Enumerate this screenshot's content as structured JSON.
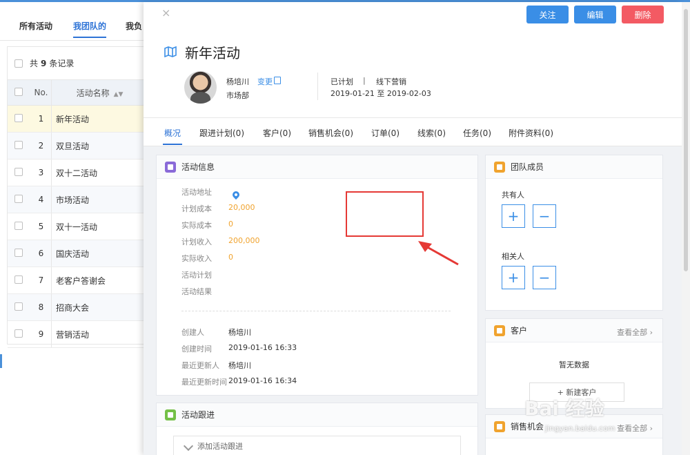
{
  "list_page": {
    "tabs": [
      "所有活动",
      "我团队的",
      "我负"
    ],
    "count": {
      "prefix": "共",
      "number": "9",
      "suffix": "条记录"
    },
    "columns": {
      "no": "No.",
      "name": "活动名称"
    },
    "rows": [
      {
        "no": "1",
        "name": "新年活动"
      },
      {
        "no": "2",
        "name": "双旦活动"
      },
      {
        "no": "3",
        "name": "双十二活动"
      },
      {
        "no": "4",
        "name": "市场活动"
      },
      {
        "no": "5",
        "name": "双十一活动"
      },
      {
        "no": "6",
        "name": "国庆活动"
      },
      {
        "no": "7",
        "name": "老客户答谢会"
      },
      {
        "no": "8",
        "name": "招商大会"
      },
      {
        "no": "9",
        "name": "营销活动"
      }
    ]
  },
  "drawer": {
    "close": "×",
    "buttons": {
      "follow": "关注",
      "edit": "编辑",
      "delete": "删除"
    },
    "title": "新年活动",
    "owner": {
      "name": "杨培川",
      "change": "变更",
      "dept": "市场部"
    },
    "status": "已计划",
    "pipe": "|",
    "type": "线下营销",
    "date_range": "2019-01-21 至 2019-02-03",
    "tabs": [
      "概况",
      "跟进计划(0)",
      "客户(0)",
      "销售机会(0)",
      "订单(0)",
      "线索(0)",
      "任务(0)",
      "附件资料(0)"
    ],
    "activity_info": {
      "title": "活动信息",
      "fields": [
        {
          "k": "活动地址",
          "v": ""
        },
        {
          "k": "计划成本",
          "v": "20,000"
        },
        {
          "k": "实际成本",
          "v": "0"
        },
        {
          "k": "计划收入",
          "v": "200,000"
        },
        {
          "k": "实际收入",
          "v": "0"
        },
        {
          "k": "活动计划",
          "v": ""
        },
        {
          "k": "活动结果",
          "v": ""
        }
      ],
      "meta": [
        {
          "k": "创建人",
          "v": "杨培川"
        },
        {
          "k": "创建时间",
          "v": "2019-01-16 16:33"
        },
        {
          "k": "最近更新人",
          "v": "杨培川"
        },
        {
          "k": "最近更新时间",
          "v": "2019-01-16 16:34"
        }
      ]
    },
    "team": {
      "title": "团队成员",
      "shared_label": "共有人",
      "related_label": "相关人",
      "plus": "+",
      "minus": "−"
    },
    "customers": {
      "title": "客户",
      "view_all": "查看全部 ›",
      "empty": "暂无数据",
      "new_btn": "+ 新建客户"
    },
    "opportunities": {
      "title": "销售机会",
      "view_all": "查看全部 ›"
    },
    "follow": {
      "title": "活动跟进",
      "add": "添加活动跟进"
    }
  },
  "watermark": {
    "main": "Bai 经验",
    "sub": "jingyan.baidu.com"
  },
  "colors": {
    "primary": "#3a8ee6",
    "danger": "#f35a63",
    "highlight": "#e53935",
    "money": "#f0a32e"
  }
}
